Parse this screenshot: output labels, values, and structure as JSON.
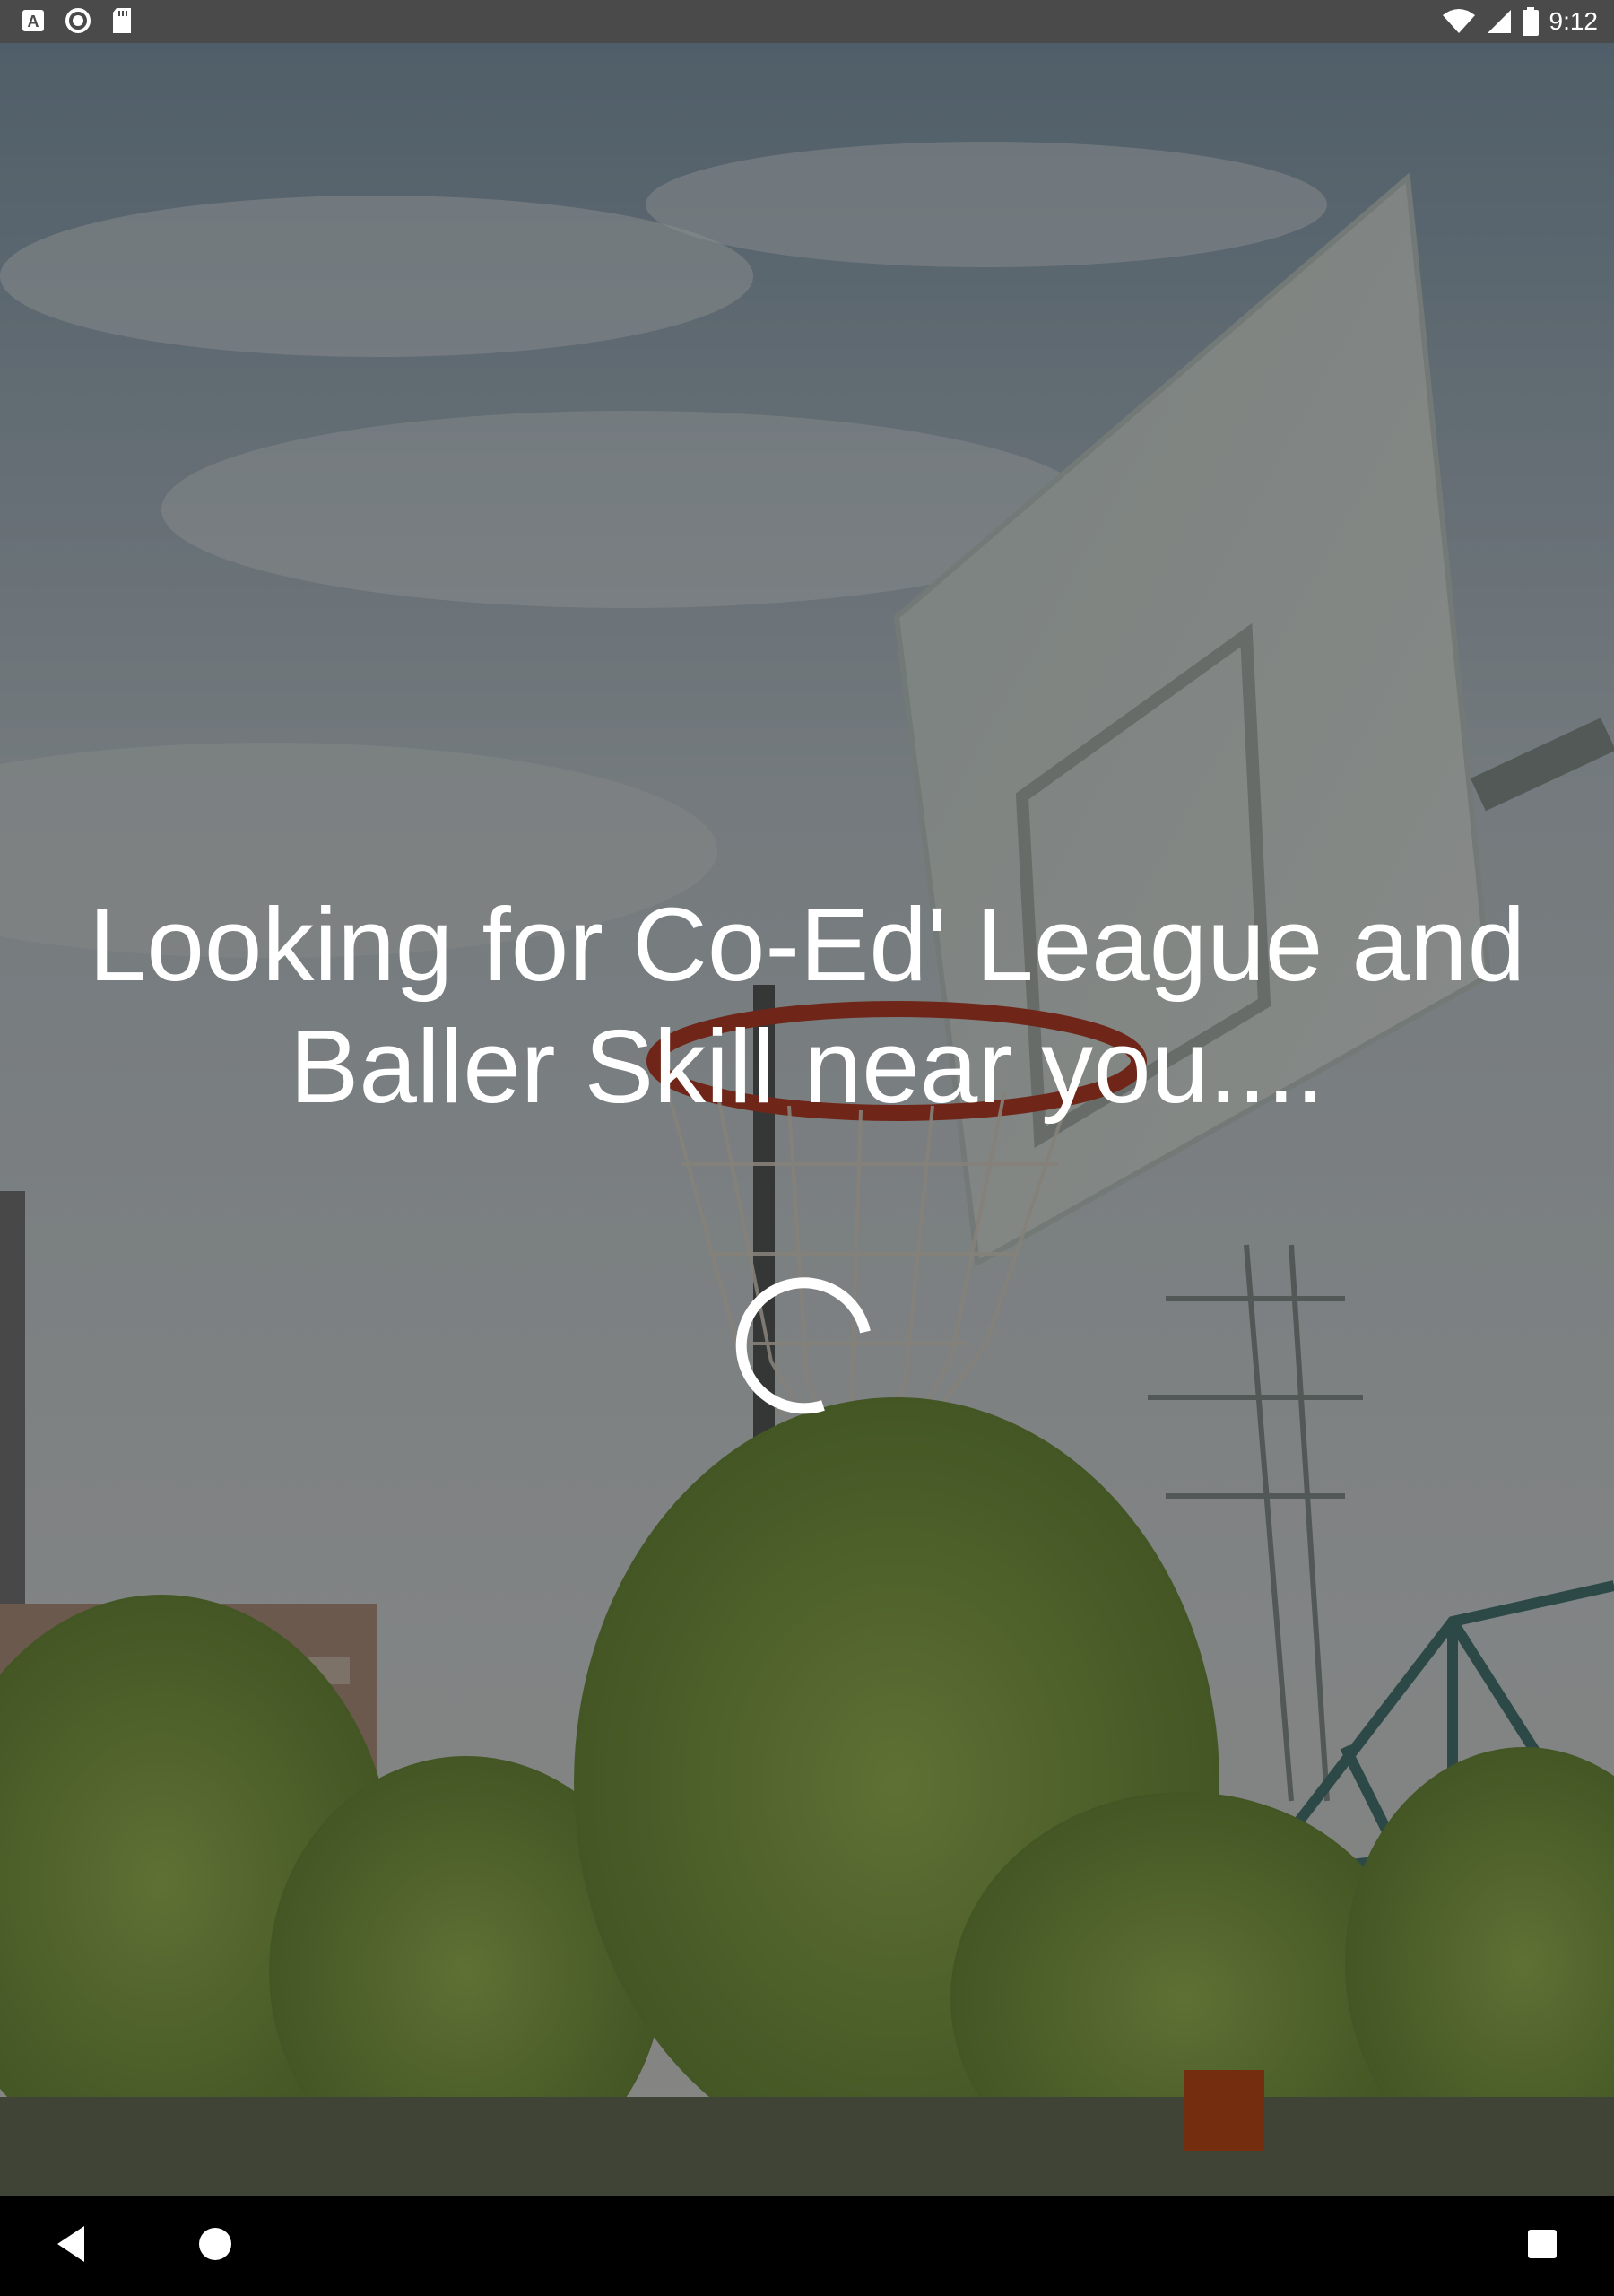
{
  "status_bar": {
    "time": "9:12",
    "left_icons": [
      "a-icon",
      "circle-icon",
      "sd-card-icon"
    ],
    "right_icons": [
      "wifi-icon",
      "signal-icon",
      "battery-icon"
    ]
  },
  "main": {
    "message": "Looking for Co-Ed' League and Baller Skill near you....",
    "loading_indicator": "spinner"
  },
  "nav_bar": {
    "buttons": [
      "back-icon",
      "home-icon",
      "recents-icon"
    ]
  },
  "colors": {
    "overlay": "#000000",
    "text": "#ffffff",
    "status_bar": "#4a4a4a",
    "nav_bar": "#000000"
  }
}
